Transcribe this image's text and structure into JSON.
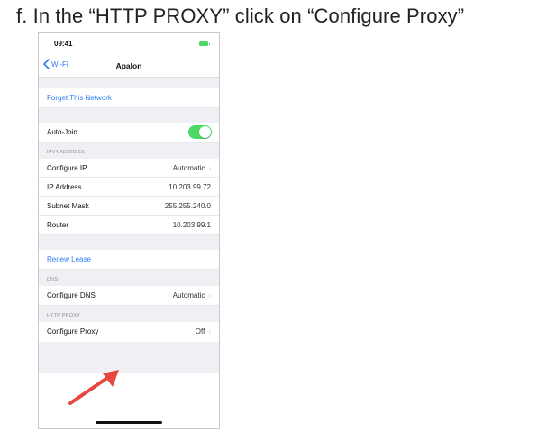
{
  "instruction": "f. In the “HTTP PROXY” click on “Configure Proxy”",
  "status_bar": {
    "time": "09:41",
    "battery_color": "#4cd964"
  },
  "nav": {
    "back_label": "Wi-Fi",
    "title": "Apalon"
  },
  "forget_network": "Forget This Network",
  "auto_join": {
    "label": "Auto-Join",
    "enabled": true
  },
  "ipv4": {
    "header": "IPV4 ADDRESS",
    "configure_ip_label": "Configure IP",
    "configure_ip_value": "Automatic",
    "ip_address_label": "IP Address",
    "ip_address_value": "10.203.99.72",
    "subnet_mask_label": "Subnet Mask",
    "subnet_mask_value": "255.255.240.0",
    "router_label": "Router",
    "router_value": "10.203.99.1"
  },
  "renew_lease": "Renew Lease",
  "dns": {
    "header": "DNS",
    "configure_dns_label": "Configure DNS",
    "configure_dns_value": "Automatic"
  },
  "http_proxy": {
    "header": "HTTP PROXY",
    "configure_proxy_label": "Configure Proxy",
    "configure_proxy_value": "Off"
  },
  "colors": {
    "ios_blue": "#2f7cf6",
    "toggle_green": "#4cd964",
    "arrow_red": "#e8473f",
    "group_background": "#efeff4"
  },
  "icons": {
    "back": "chevron-left-icon",
    "disclosure": "chevron-right-icon",
    "annotation": "red-arrow-icon"
  }
}
